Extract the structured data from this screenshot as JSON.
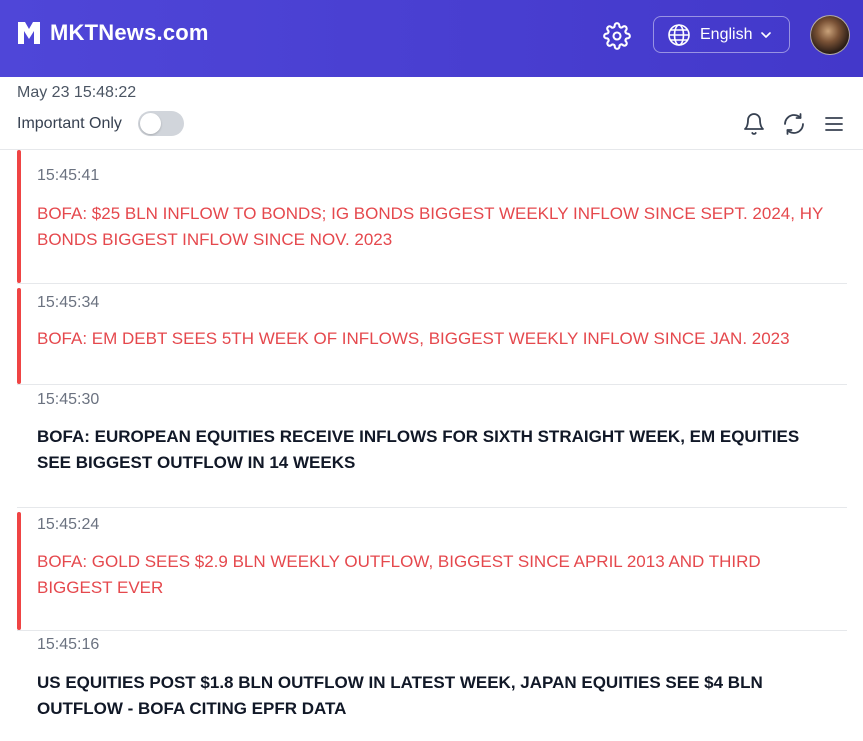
{
  "header": {
    "brand": "MKTNews.com",
    "language": "English"
  },
  "subbar": {
    "datetime": "May 23 15:48:22",
    "important_only_label": "Important Only",
    "important_only_enabled": false
  },
  "feed": [
    {
      "time": "15:45:41",
      "important": true,
      "text": "BOFA: $25 BLN INFLOW TO BONDS; IG BONDS BIGGEST WEEKLY INFLOW SINCE SEPT. 2024, HY BONDS BIGGEST INFLOW SINCE NOV. 2023"
    },
    {
      "time": "15:45:34",
      "important": true,
      "text": "BOFA: EM DEBT SEES 5TH WEEK OF INFLOWS, BIGGEST WEEKLY INFLOW SINCE JAN. 2023"
    },
    {
      "time": "15:45:30",
      "important": false,
      "text": "BOFA: EUROPEAN EQUITIES RECEIVE INFLOWS FOR SIXTH STRAIGHT WEEK, EM EQUITIES SEE BIGGEST OUTFLOW IN 14 WEEKS"
    },
    {
      "time": "15:45:24",
      "important": true,
      "text": "BOFA: GOLD SEES $2.9 BLN WEEKLY OUTFLOW, BIGGEST SINCE APRIL 2013 AND THIRD BIGGEST EVER"
    },
    {
      "time": "15:45:16",
      "important": false,
      "text": "US EQUITIES POST $1.8 BLN OUTFLOW IN LATEST WEEK, JAPAN EQUITIES SEE $4 BLN OUTFLOW - BOFA CITING EPFR DATA"
    }
  ],
  "colors": {
    "header_bg": "#4338ca",
    "important_text": "#e5484d",
    "important_bar": "#ef4444"
  },
  "icons": [
    "logo-icon",
    "gear-icon",
    "globe-icon",
    "chevron-down-icon",
    "bell-icon",
    "refresh-icon",
    "menu-icon"
  ]
}
